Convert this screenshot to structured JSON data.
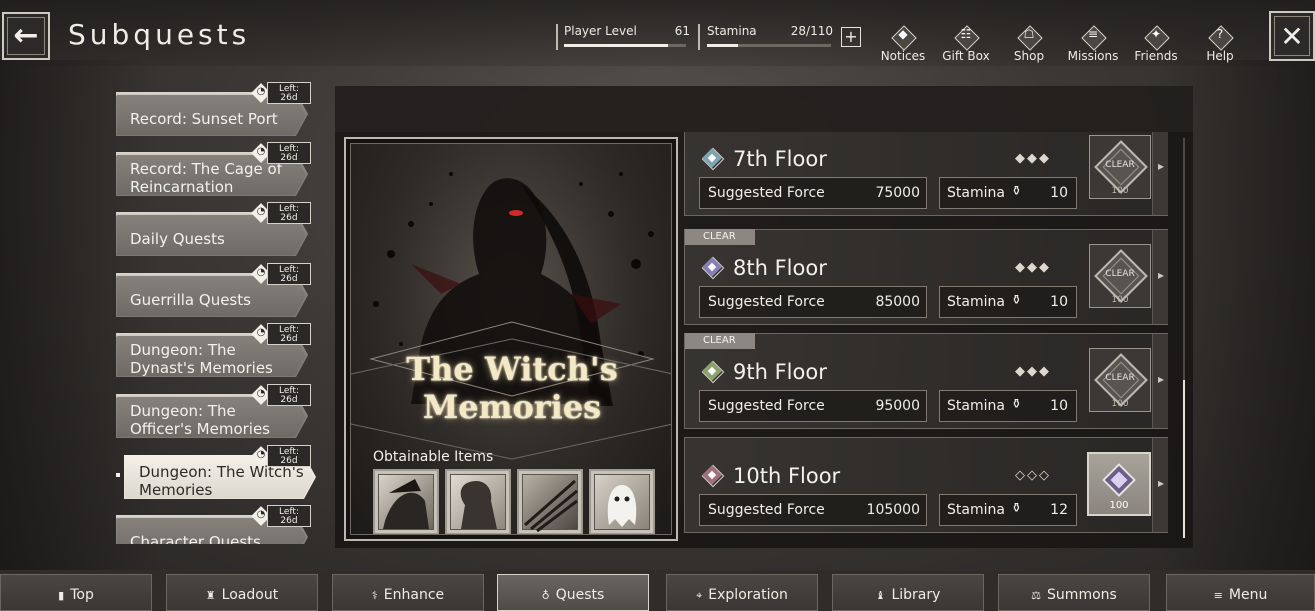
{
  "header": {
    "title": "Subquests",
    "player_level_label": "Player Level",
    "player_level_value": "61",
    "player_level_progress": 0.85,
    "stamina_label": "Stamina",
    "stamina_value": "28/110",
    "stamina_progress": 0.25,
    "nav": [
      {
        "label": "Notices",
        "icon": "notices-icon"
      },
      {
        "label": "Gift Box",
        "icon": "gift-icon"
      },
      {
        "label": "Shop",
        "icon": "shop-icon"
      },
      {
        "label": "Missions",
        "icon": "missions-icon"
      },
      {
        "label": "Friends",
        "icon": "friends-icon"
      },
      {
        "label": "Help",
        "icon": "help-icon"
      }
    ]
  },
  "quests": [
    {
      "name": "Record: Sunset Port",
      "left_label": "Left:",
      "left_value": "26d"
    },
    {
      "name": "Record: The Cage of Reincarnation",
      "left_label": "Left:",
      "left_value": "26d"
    },
    {
      "name": "Daily Quests",
      "left_label": "Left:",
      "left_value": "26d"
    },
    {
      "name": "Guerrilla Quests",
      "left_label": "Left:",
      "left_value": "26d"
    },
    {
      "name": "Dungeon: The Dynast's Memories",
      "left_label": "Left:",
      "left_value": "26d"
    },
    {
      "name": "Dungeon: The Officer's Memories",
      "left_label": "Left:",
      "left_value": "26d"
    },
    {
      "name": "Dungeon: The Witch's Memories",
      "left_label": "Left:",
      "left_value": "26d",
      "active": true
    },
    {
      "name": "Character Quests",
      "left_label": "Left:",
      "left_value": "26d"
    }
  ],
  "featured": {
    "title_line1": "The Witch's",
    "title_line2": "Memories",
    "obtainable_label": "Obtainable Items"
  },
  "floors": [
    {
      "name": "7th Floor",
      "force_label": "Suggested Force",
      "force": "75000",
      "stamina_label": "Stamina",
      "stamina_cost": "10",
      "stars": "◆◆◆",
      "clear_tag": "",
      "badge": "CLEAR",
      "badge_count": "100",
      "gem_color": "#7fa3b0"
    },
    {
      "name": "8th Floor",
      "force_label": "Suggested Force",
      "force": "85000",
      "stamina_label": "Stamina",
      "stamina_cost": "10",
      "stars": "◆◆◆",
      "clear_tag": "CLEAR",
      "badge": "CLEAR",
      "badge_count": "100",
      "gem_color": "#8a7fb5"
    },
    {
      "name": "9th Floor",
      "force_label": "Suggested Force",
      "force": "95000",
      "stamina_label": "Stamina",
      "stamina_cost": "10",
      "stars": "◆◆◆",
      "clear_tag": "CLEAR",
      "badge": "CLEAR",
      "badge_count": "100",
      "gem_color": "#8aa36b"
    },
    {
      "name": "10th Floor",
      "force_label": "Suggested Force",
      "force": "105000",
      "stamina_label": "Stamina",
      "stamina_cost": "12",
      "stars": "◇◇◇",
      "clear_tag": "",
      "badge": "",
      "badge_count": "100",
      "gem_color": "#a0707e"
    }
  ],
  "bottom_nav": [
    {
      "label": "Top",
      "icon": "top-icon"
    },
    {
      "label": "Loadout",
      "icon": "loadout-icon"
    },
    {
      "label": "Enhance",
      "icon": "enhance-icon"
    },
    {
      "label": "Quests",
      "icon": "quests-icon",
      "active": true
    },
    {
      "label": "Exploration",
      "icon": "exploration-icon"
    },
    {
      "label": "Library",
      "icon": "library-icon"
    },
    {
      "label": "Summons",
      "icon": "summons-icon"
    },
    {
      "label": "Menu",
      "icon": "menu-icon"
    }
  ]
}
